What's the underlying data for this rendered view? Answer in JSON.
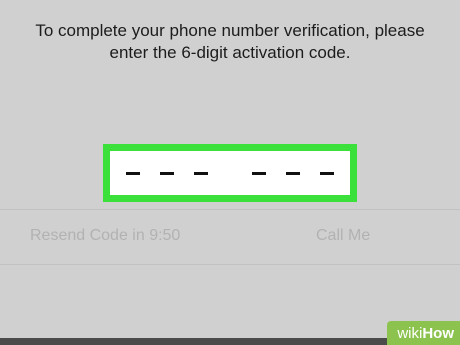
{
  "instruction": {
    "line1": "To complete your phone number verification, please",
    "line2": "enter the 6-digit activation code."
  },
  "code_input": {
    "digit_count": 6,
    "entered_digits": "",
    "highlight_color": "#3ce03a"
  },
  "actions": {
    "resend_label": "Resend Code in 9:50",
    "call_label": "Call Me"
  },
  "watermark": {
    "wiki": "wiki",
    "how": "How",
    "color": "#8cc34f"
  }
}
